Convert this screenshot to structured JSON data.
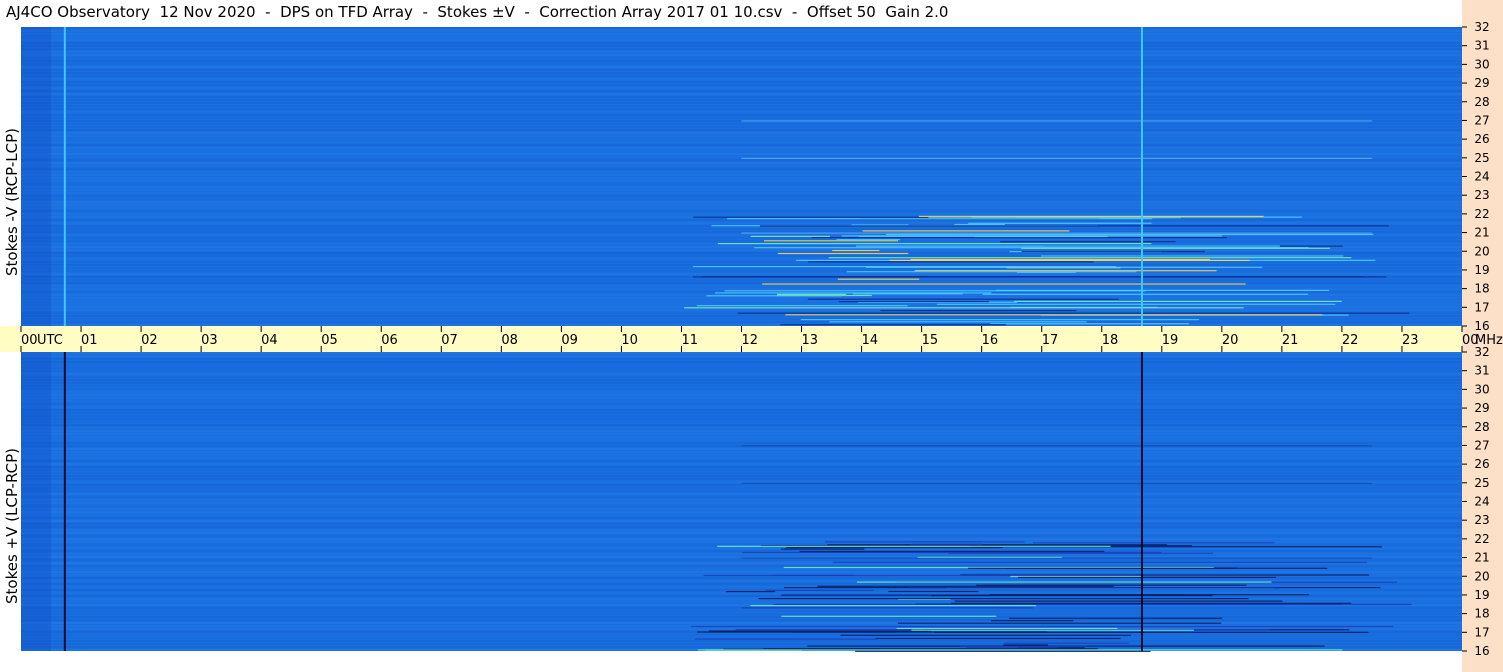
{
  "title": "AJ4CO Observatory  12 Nov 2020  -  DPS on TFD Array  -  Stokes ±V  -  Correction Array 2017 01 10.csv  -  Offset 50  Gain 2.0",
  "colors": {
    "background_blue": "#1a6fe0",
    "axis_band": "#fffdc4",
    "right_strip": "#fde0c8",
    "top_marker": "#3ec8ff",
    "bottom_marker": "#050a2a"
  },
  "chart_data": [
    {
      "type": "heatmap",
      "name": "Stokes -V (RCP-LCP)",
      "ylabel": "Stokes -V (RCP-LCP)",
      "xlabel": "UTC",
      "ylabel_right": "MHz",
      "x_ticks": [
        "00",
        "01",
        "02",
        "03",
        "04",
        "05",
        "06",
        "07",
        "08",
        "09",
        "10",
        "11",
        "12",
        "13",
        "14",
        "15",
        "16",
        "17",
        "18",
        "19",
        "20",
        "21",
        "22",
        "23",
        "00"
      ],
      "y_ticks": [
        16,
        17,
        18,
        19,
        20,
        21,
        22,
        23,
        24,
        25,
        26,
        27,
        28,
        29,
        30,
        31,
        32
      ],
      "xlim": [
        0,
        24
      ],
      "ylim": [
        16,
        32
      ],
      "vertical_marker_utc": [
        0.73,
        18.67
      ],
      "emission_region": {
        "start_utc": 11,
        "end_utc": 23.2,
        "freq_range": [
          16,
          22
        ]
      }
    },
    {
      "type": "heatmap",
      "name": "Stokes +V (LCP-RCP)",
      "ylabel": "Stokes +V (LCP-RCP)",
      "xlabel": "UTC",
      "ylabel_right": "MHz",
      "x_ticks": [
        "00",
        "01",
        "02",
        "03",
        "04",
        "05",
        "06",
        "07",
        "08",
        "09",
        "10",
        "11",
        "12",
        "13",
        "14",
        "15",
        "16",
        "17",
        "18",
        "19",
        "20",
        "21",
        "22",
        "23",
        "00"
      ],
      "y_ticks": [
        16,
        17,
        18,
        19,
        20,
        21,
        22,
        23,
        24,
        25,
        26,
        27,
        28,
        29,
        30,
        31,
        32
      ],
      "xlim": [
        0,
        24
      ],
      "ylim": [
        16,
        32
      ],
      "vertical_marker_utc": [
        0.73,
        18.67
      ],
      "emission_region": {
        "start_utc": 11,
        "end_utc": 23.2,
        "freq_range": [
          16,
          22
        ]
      }
    }
  ],
  "axis_band_labels": {
    "utc_label": "UTC",
    "mhz_label": "MHz"
  }
}
